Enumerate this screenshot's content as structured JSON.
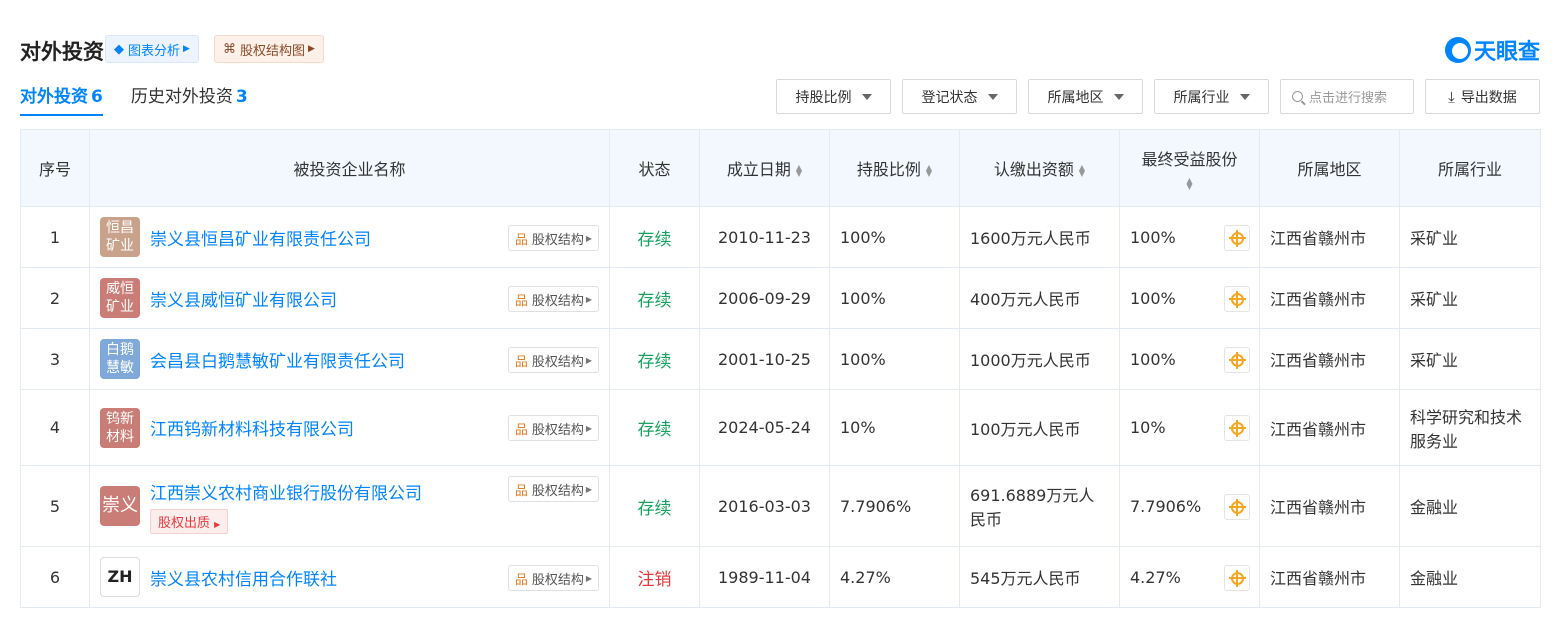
{
  "header": {
    "title": "对外投资",
    "chart_btn": "图表分析",
    "equity_btn": "股权结构图",
    "brand": "天眼查"
  },
  "tabs": [
    {
      "label": "对外投资",
      "count": "6"
    },
    {
      "label": "历史对外投资",
      "count": "3"
    }
  ],
  "filters": {
    "ratio": "持股比例",
    "status": "登记状态",
    "region": "所属地区",
    "industry": "所属行业",
    "search_placeholder": "点击进行搜索",
    "export": "导出数据"
  },
  "columns": [
    "序号",
    "被投资企业名称",
    "状态",
    "成立日期",
    "持股比例",
    "认缴出资额",
    "最终受益股份",
    "所属地区",
    "所属行业"
  ],
  "equity_label": "股权结构",
  "rows": [
    {
      "no": "1",
      "logo": "恒昌矿业",
      "logo_color": "#c9a28c",
      "name": "崇义县恒昌矿业有限责任公司",
      "status": "存续",
      "date": "2010-11-23",
      "ratio": "100%",
      "capital": "1600万元人民币",
      "benefit": "100%",
      "region": "江西省赣州市",
      "industry": "采矿业"
    },
    {
      "no": "2",
      "logo": "威恒矿业",
      "logo_color": "#c97d76",
      "name": "崇义县威恒矿业有限公司",
      "status": "存续",
      "date": "2006-09-29",
      "ratio": "100%",
      "capital": "400万元人民币",
      "benefit": "100%",
      "region": "江西省赣州市",
      "industry": "采矿业"
    },
    {
      "no": "3",
      "logo": "白鹅慧敏",
      "logo_color": "#7fa9d8",
      "name": "会昌县白鹅慧敏矿业有限责任公司",
      "status": "存续",
      "date": "2001-10-25",
      "ratio": "100%",
      "capital": "1000万元人民币",
      "benefit": "100%",
      "region": "江西省赣州市",
      "industry": "采矿业"
    },
    {
      "no": "4",
      "logo": "钨新材料",
      "logo_color": "#c97d76",
      "name": "江西钨新材料科技有限公司",
      "status": "存续",
      "date": "2024-05-24",
      "ratio": "10%",
      "capital": "100万元人民币",
      "benefit": "10%",
      "region": "江西省赣州市",
      "industry": "科学研究和技术服务业"
    },
    {
      "no": "5",
      "logo": "崇义",
      "logo_color": "#c97d76",
      "name": "江西崇义农村商业银行股份有限公司",
      "pledge": "股权出质",
      "status": "存续",
      "date": "2016-03-03",
      "ratio": "7.7906%",
      "capital": "691.6889万元人民币",
      "benefit": "7.7906%",
      "region": "江西省赣州市",
      "industry": "金融业"
    },
    {
      "no": "6",
      "logo": "ZH",
      "logo_color": "#ffffff",
      "name": "崇义县农村信用合作联社",
      "status": "注销",
      "date": "1989-11-04",
      "ratio": "4.27%",
      "capital": "545万元人民币",
      "benefit": "4.27%",
      "region": "江西省赣州市",
      "industry": "金融业"
    }
  ]
}
